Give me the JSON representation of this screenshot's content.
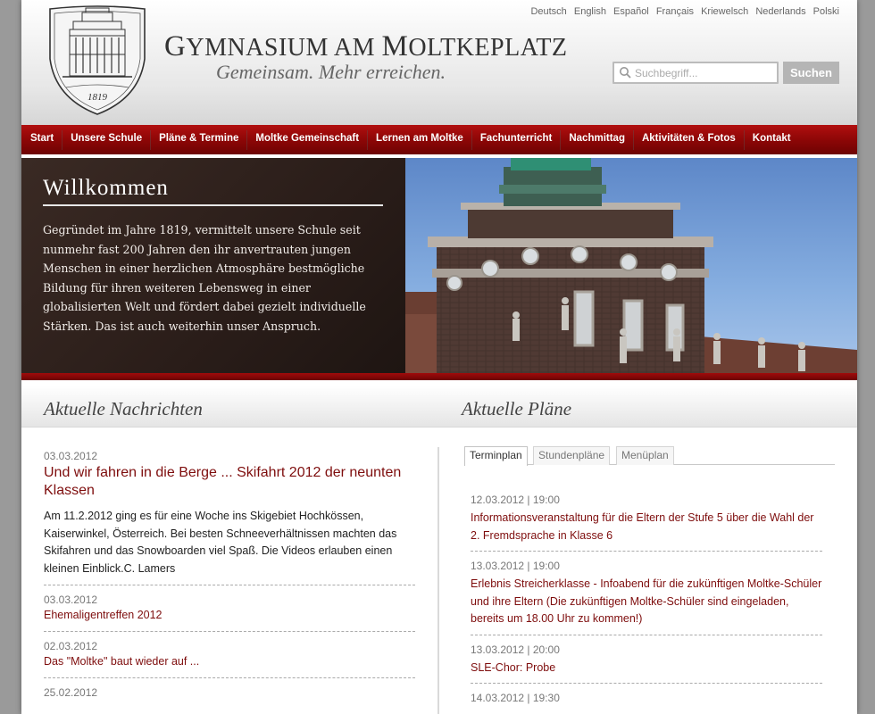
{
  "header": {
    "title_first": "G",
    "title_rest": "YMNASIUM AM ",
    "title_m": "M",
    "title_end": "OLTKEPLATZ",
    "tagline": "Gemeinsam. Mehr erreichen.",
    "logo_year": "1819"
  },
  "languages": [
    "Deutsch",
    "English",
    "Español",
    "Français",
    "Kriewelsch",
    "Nederlands",
    "Polski"
  ],
  "search": {
    "placeholder": "Suchbegriff...",
    "button_label": "Suchen"
  },
  "nav": [
    "Start",
    "Unsere Schule",
    "Pläne & Termine",
    "Moltke Gemeinschaft",
    "Lernen am Moltke",
    "Fachunterricht",
    "Nachmittag",
    "Aktivitäten & Fotos",
    "Kontakt"
  ],
  "hero": {
    "title": "Willkommen",
    "body": "Gegründet im Jahre 1819, vermittelt unsere Schule seit nunmehr fast 200 Jahren den ihr anvertrauten jungen Menschen in einer herzlichen Atmosphäre bestmögliche Bildung für ihren weiteren Lebensweg in einer globalisierten Welt und fördert dabei gezielt individuelle Stärken. Das ist auch weiterhin unser Anspruch."
  },
  "news": {
    "heading": "Aktuelle Nachrichten",
    "items": [
      {
        "date": "03.03.2012",
        "title": "Und wir fahren in die Berge ... Skifahrt 2012 der neunten Klassen",
        "text": "Am 11.2.2012 ging es für eine Woche ins Skigebiet Hochkössen, Kaiserwinkel, Österreich. Bei besten Schneeverhältnissen machten das Skifahren und das Snowboarden viel Spaß. Die Videos erlauben einen kleinen Einblick.C. Lamers"
      },
      {
        "date": "03.03.2012",
        "title": "Ehemaligentreffen 2012"
      },
      {
        "date": "02.03.2012",
        "title": "Das \"Moltke\" baut wieder auf ..."
      },
      {
        "date": "25.02.2012",
        "title": ""
      }
    ]
  },
  "plans": {
    "heading": "Aktuelle Pläne",
    "tabs": [
      "Terminplan",
      "Stundenpläne",
      "Menüplan"
    ],
    "events": [
      {
        "date": "12.03.2012 | 19:00",
        "title": "Informationsveranstaltung für die Eltern der Stufe 5 über die Wahl der 2. Fremdsprache in Klasse 6"
      },
      {
        "date": "13.03.2012 | 19:00",
        "title": "Erlebnis Streicherklasse - Infoabend für die zukünftigen Moltke-Schüler und ihre Eltern (Die zukünftigen Moltke-Schüler sind eingeladen, bereits um 18.00 Uhr zu kommen!)"
      },
      {
        "date": "13.03.2012 | 20:00",
        "title": "SLE-Chor: Probe"
      },
      {
        "date": "14.03.2012 | 19:30",
        "title": ""
      }
    ]
  }
}
